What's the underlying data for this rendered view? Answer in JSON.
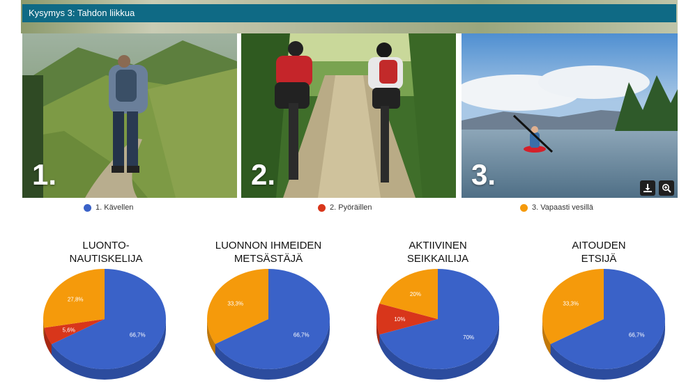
{
  "header": {
    "title": "Kysymys 3: Tahdon liikkua"
  },
  "photos": [
    {
      "number": "1."
    },
    {
      "number": "2."
    },
    {
      "number": "3."
    }
  ],
  "toolbar": {
    "download_icon": "download-icon",
    "zoom_icon": "zoom-in-icon"
  },
  "legend": [
    {
      "label": "1. Kävellen",
      "color": "#3a62c8"
    },
    {
      "label": "2. Pyöräillen",
      "color": "#d8361b"
    },
    {
      "label": "3. Vapaasti vesillä",
      "color": "#f59a0b"
    }
  ],
  "chart_data": [
    {
      "type": "pie",
      "title": "LUONTO-\nNAUTISKELIJA",
      "categories": [
        "1. Kävellen",
        "2. Pyöräillen",
        "3. Vapaasti vesillä"
      ],
      "values": [
        66.7,
        5.6,
        27.8
      ],
      "labels": [
        "66,7%",
        "5,6%",
        "27,8%"
      ]
    },
    {
      "type": "pie",
      "title": "LUONNON IHMEIDEN\nMETSÄSTÄJÄ",
      "categories": [
        "1. Kävellen",
        "2. Pyöräillen",
        "3. Vapaasti vesillä"
      ],
      "values": [
        66.7,
        0,
        33.3
      ],
      "labels": [
        "66,7%",
        "",
        "33,3%"
      ]
    },
    {
      "type": "pie",
      "title": "AKTIIVINEN\nSEIKKAILIJA",
      "categories": [
        "1. Kävellen",
        "2. Pyöräillen",
        "3. Vapaasti vesillä"
      ],
      "values": [
        70,
        10,
        20
      ],
      "labels": [
        "70%",
        "10%",
        "20%"
      ]
    },
    {
      "type": "pie",
      "title": "AITOUDEN\nETSIJÄ",
      "categories": [
        "1. Kävellen",
        "2. Pyöräillen",
        "3. Vapaasti vesillä"
      ],
      "values": [
        66.7,
        0,
        33.3
      ],
      "labels": [
        "66,7%",
        "",
        "33,3%"
      ]
    }
  ]
}
